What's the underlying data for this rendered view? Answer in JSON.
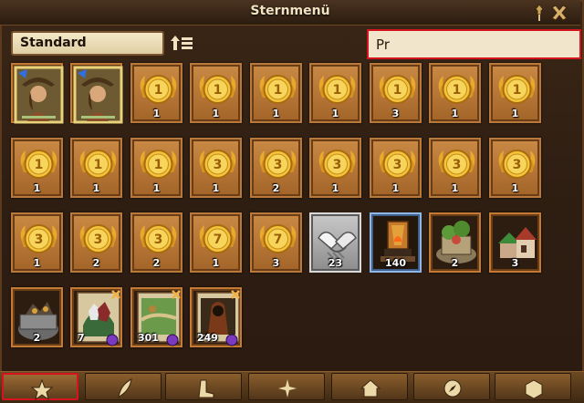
{
  "window": {
    "title": "Sternmenü",
    "pin_icon": "pin-icon",
    "close_icon": "close-icon"
  },
  "toolbar": {
    "filter_value": "Standard",
    "sort_icon": "sort-icon",
    "search_value": "Pr"
  },
  "colors": {
    "highlight": "#d5141d",
    "slot_border": "#b9793b",
    "text_light": "#f1e3c2"
  },
  "items": {
    "row1": [
      {
        "icon": "explorer-portrait-icon",
        "count": ""
      },
      {
        "icon": "explorer-portrait-icon",
        "count": ""
      },
      {
        "icon": "gold-medal-1-icon",
        "medal": "1",
        "count": "1"
      },
      {
        "icon": "gold-medal-1-icon",
        "medal": "1",
        "count": "1"
      },
      {
        "icon": "gold-medal-1-icon",
        "medal": "1",
        "count": "1"
      },
      {
        "icon": "gold-medal-1-icon",
        "medal": "1",
        "count": "1"
      },
      {
        "icon": "gold-medal-1-icon",
        "medal": "1",
        "count": "3"
      },
      {
        "icon": "gold-medal-1-icon",
        "medal": "1",
        "count": "1"
      },
      {
        "icon": "gold-medal-1-icon",
        "medal": "1",
        "count": "1"
      }
    ],
    "row2": [
      {
        "icon": "gold-medal-1-icon",
        "medal": "1",
        "count": "1"
      },
      {
        "icon": "gold-medal-1-icon",
        "medal": "1",
        "count": "1"
      },
      {
        "icon": "gold-medal-1-icon",
        "medal": "1",
        "count": "1"
      },
      {
        "icon": "gold-medal-3-icon",
        "medal": "3",
        "count": "1"
      },
      {
        "icon": "gold-medal-3-icon",
        "medal": "3",
        "count": "2"
      },
      {
        "icon": "gold-medal-3-icon",
        "medal": "3",
        "count": "1"
      },
      {
        "icon": "gold-medal-3-icon",
        "medal": "3",
        "count": "1"
      },
      {
        "icon": "gold-medal-3-icon",
        "medal": "3",
        "count": "1"
      },
      {
        "icon": "gold-medal-3-icon",
        "medal": "3",
        "count": "1"
      }
    ],
    "row3": [
      {
        "icon": "gold-medal-3-icon",
        "medal": "3",
        "count": "1"
      },
      {
        "icon": "gold-medal-3-icon",
        "medal": "3",
        "count": "2"
      },
      {
        "icon": "gold-medal-3-icon",
        "medal": "3",
        "count": "2"
      },
      {
        "icon": "gold-medal-7-icon",
        "medal": "7",
        "count": "1"
      },
      {
        "icon": "gold-medal-7-icon",
        "medal": "7",
        "count": "3"
      },
      {
        "icon": "handshake-icon",
        "count": "23"
      },
      {
        "icon": "forge-icon",
        "count": "140"
      },
      {
        "icon": "garden-building-icon",
        "count": "2"
      },
      {
        "icon": "houses-building-icon",
        "count": "3"
      }
    ],
    "row4": [
      {
        "icon": "ore-mine-building-icon",
        "count": "2"
      },
      {
        "icon": "adventure-card-icon",
        "count": "7"
      },
      {
        "icon": "map-card-icon",
        "count": "301"
      },
      {
        "icon": "bandit-card-icon",
        "count": "249"
      }
    ]
  },
  "tabs": [
    {
      "name": "star-tab",
      "icon": "star-icon"
    },
    {
      "name": "resources-tab",
      "icon": "feather-icon"
    },
    {
      "name": "buffs-tab",
      "icon": "boot-icon"
    },
    {
      "name": "specialists-tab",
      "icon": "sparkle-icon"
    },
    {
      "name": "buildings-tab",
      "icon": "house-icon"
    },
    {
      "name": "misc-tab",
      "icon": "compass-icon"
    },
    {
      "name": "loot-tab",
      "icon": "box-icon"
    }
  ]
}
